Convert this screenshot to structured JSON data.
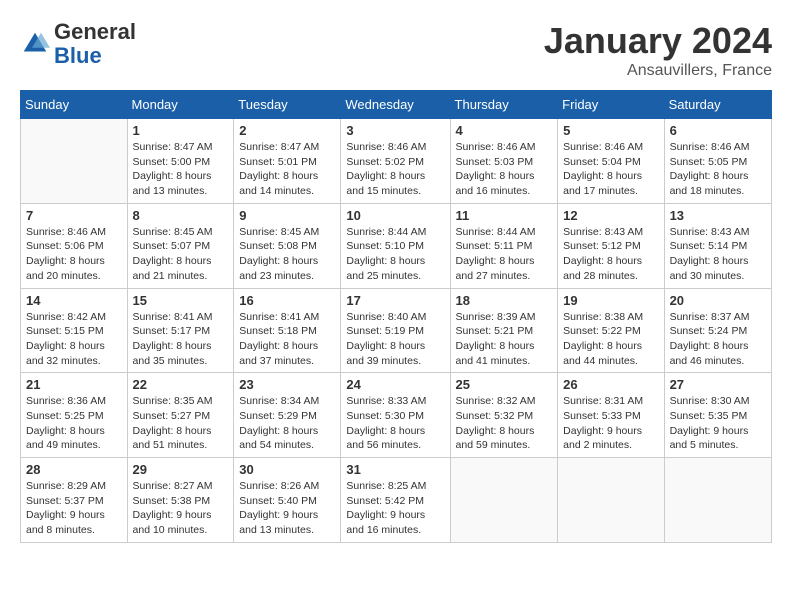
{
  "header": {
    "logo_general": "General",
    "logo_blue": "Blue",
    "month_title": "January 2024",
    "location": "Ansauvillers, France"
  },
  "columns": [
    "Sunday",
    "Monday",
    "Tuesday",
    "Wednesday",
    "Thursday",
    "Friday",
    "Saturday"
  ],
  "weeks": [
    [
      {
        "day": "",
        "info": ""
      },
      {
        "day": "1",
        "info": "Sunrise: 8:47 AM\nSunset: 5:00 PM\nDaylight: 8 hours\nand 13 minutes."
      },
      {
        "day": "2",
        "info": "Sunrise: 8:47 AM\nSunset: 5:01 PM\nDaylight: 8 hours\nand 14 minutes."
      },
      {
        "day": "3",
        "info": "Sunrise: 8:46 AM\nSunset: 5:02 PM\nDaylight: 8 hours\nand 15 minutes."
      },
      {
        "day": "4",
        "info": "Sunrise: 8:46 AM\nSunset: 5:03 PM\nDaylight: 8 hours\nand 16 minutes."
      },
      {
        "day": "5",
        "info": "Sunrise: 8:46 AM\nSunset: 5:04 PM\nDaylight: 8 hours\nand 17 minutes."
      },
      {
        "day": "6",
        "info": "Sunrise: 8:46 AM\nSunset: 5:05 PM\nDaylight: 8 hours\nand 18 minutes."
      }
    ],
    [
      {
        "day": "7",
        "info": "Sunrise: 8:46 AM\nSunset: 5:06 PM\nDaylight: 8 hours\nand 20 minutes."
      },
      {
        "day": "8",
        "info": "Sunrise: 8:45 AM\nSunset: 5:07 PM\nDaylight: 8 hours\nand 21 minutes."
      },
      {
        "day": "9",
        "info": "Sunrise: 8:45 AM\nSunset: 5:08 PM\nDaylight: 8 hours\nand 23 minutes."
      },
      {
        "day": "10",
        "info": "Sunrise: 8:44 AM\nSunset: 5:10 PM\nDaylight: 8 hours\nand 25 minutes."
      },
      {
        "day": "11",
        "info": "Sunrise: 8:44 AM\nSunset: 5:11 PM\nDaylight: 8 hours\nand 27 minutes."
      },
      {
        "day": "12",
        "info": "Sunrise: 8:43 AM\nSunset: 5:12 PM\nDaylight: 8 hours\nand 28 minutes."
      },
      {
        "day": "13",
        "info": "Sunrise: 8:43 AM\nSunset: 5:14 PM\nDaylight: 8 hours\nand 30 minutes."
      }
    ],
    [
      {
        "day": "14",
        "info": "Sunrise: 8:42 AM\nSunset: 5:15 PM\nDaylight: 8 hours\nand 32 minutes."
      },
      {
        "day": "15",
        "info": "Sunrise: 8:41 AM\nSunset: 5:17 PM\nDaylight: 8 hours\nand 35 minutes."
      },
      {
        "day": "16",
        "info": "Sunrise: 8:41 AM\nSunset: 5:18 PM\nDaylight: 8 hours\nand 37 minutes."
      },
      {
        "day": "17",
        "info": "Sunrise: 8:40 AM\nSunset: 5:19 PM\nDaylight: 8 hours\nand 39 minutes."
      },
      {
        "day": "18",
        "info": "Sunrise: 8:39 AM\nSunset: 5:21 PM\nDaylight: 8 hours\nand 41 minutes."
      },
      {
        "day": "19",
        "info": "Sunrise: 8:38 AM\nSunset: 5:22 PM\nDaylight: 8 hours\nand 44 minutes."
      },
      {
        "day": "20",
        "info": "Sunrise: 8:37 AM\nSunset: 5:24 PM\nDaylight: 8 hours\nand 46 minutes."
      }
    ],
    [
      {
        "day": "21",
        "info": "Sunrise: 8:36 AM\nSunset: 5:25 PM\nDaylight: 8 hours\nand 49 minutes."
      },
      {
        "day": "22",
        "info": "Sunrise: 8:35 AM\nSunset: 5:27 PM\nDaylight: 8 hours\nand 51 minutes."
      },
      {
        "day": "23",
        "info": "Sunrise: 8:34 AM\nSunset: 5:29 PM\nDaylight: 8 hours\nand 54 minutes."
      },
      {
        "day": "24",
        "info": "Sunrise: 8:33 AM\nSunset: 5:30 PM\nDaylight: 8 hours\nand 56 minutes."
      },
      {
        "day": "25",
        "info": "Sunrise: 8:32 AM\nSunset: 5:32 PM\nDaylight: 8 hours\nand 59 minutes."
      },
      {
        "day": "26",
        "info": "Sunrise: 8:31 AM\nSunset: 5:33 PM\nDaylight: 9 hours\nand 2 minutes."
      },
      {
        "day": "27",
        "info": "Sunrise: 8:30 AM\nSunset: 5:35 PM\nDaylight: 9 hours\nand 5 minutes."
      }
    ],
    [
      {
        "day": "28",
        "info": "Sunrise: 8:29 AM\nSunset: 5:37 PM\nDaylight: 9 hours\nand 8 minutes."
      },
      {
        "day": "29",
        "info": "Sunrise: 8:27 AM\nSunset: 5:38 PM\nDaylight: 9 hours\nand 10 minutes."
      },
      {
        "day": "30",
        "info": "Sunrise: 8:26 AM\nSunset: 5:40 PM\nDaylight: 9 hours\nand 13 minutes."
      },
      {
        "day": "31",
        "info": "Sunrise: 8:25 AM\nSunset: 5:42 PM\nDaylight: 9 hours\nand 16 minutes."
      },
      {
        "day": "",
        "info": ""
      },
      {
        "day": "",
        "info": ""
      },
      {
        "day": "",
        "info": ""
      }
    ]
  ]
}
